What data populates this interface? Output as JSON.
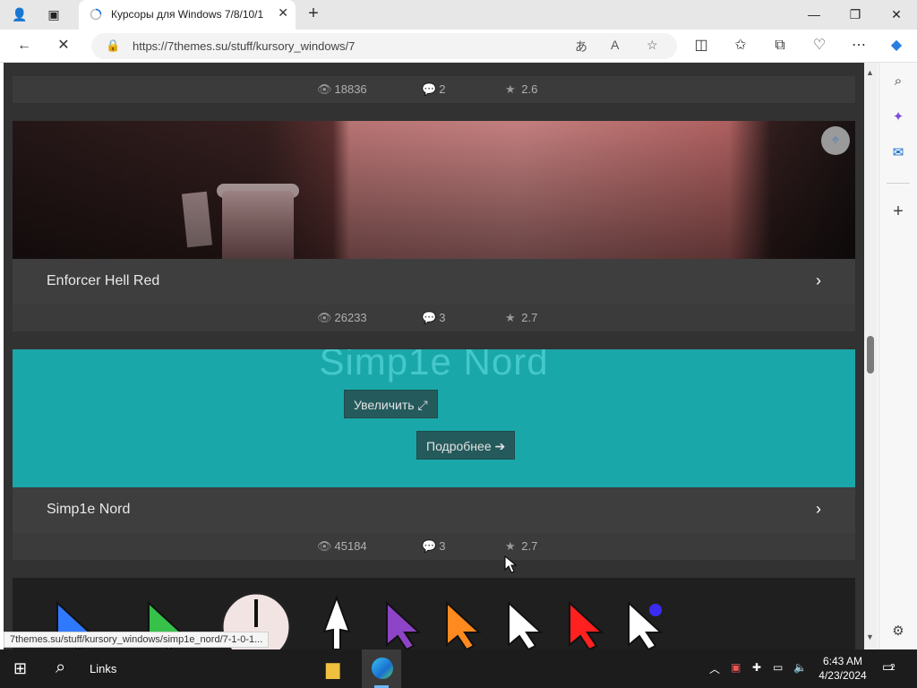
{
  "browser": {
    "tab_title": "Курсоры для Windows 7/8/10/1",
    "url": "https://7themes.su/stuff/kursory_windows/7",
    "status_url": "7themes.su/stuff/kursory_windows/simp1e_nord/7-1-0-1..."
  },
  "cards": [
    {
      "views": "18836",
      "comments": "2",
      "rating": "2.6"
    },
    {
      "title": "Enforcer Hell Red",
      "views": "26233",
      "comments": "3",
      "rating": "2.7"
    },
    {
      "title": "Simp1e Nord",
      "image_text": "Simp1e Nord",
      "zoom_label": "Увеличить",
      "more_label": "Подробнее",
      "views": "45184",
      "comments": "3",
      "rating": "2.7"
    }
  ],
  "taskbar": {
    "search_label": "Links",
    "time": "6:43 AM",
    "date": "4/23/2024",
    "notifications": "2"
  },
  "icons": [
    "profile-icon",
    "tab-actions-icon",
    "back-icon",
    "stop-icon",
    "lock-icon",
    "read-aloud-icon",
    "favorite-icon",
    "split-screen-icon",
    "favorites-icon",
    "collections-icon",
    "performance-icon",
    "more-icon",
    "copilot-icon",
    "eye-icon",
    "comments-icon",
    "star-icon",
    "chevron-right-icon",
    "search-icon",
    "add-icon",
    "settings-icon"
  ]
}
